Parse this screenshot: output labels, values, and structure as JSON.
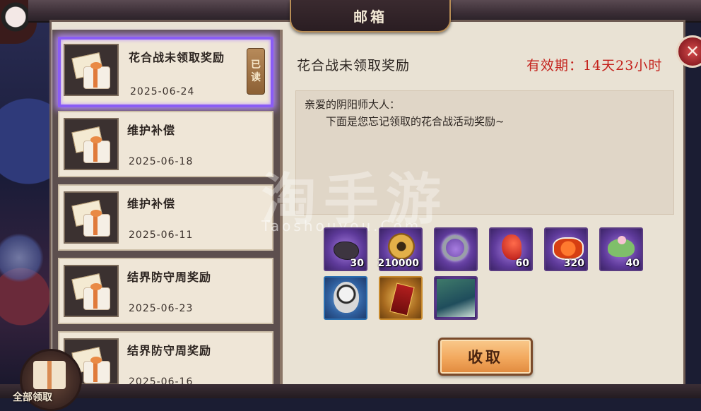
{
  "window": {
    "title": "邮箱",
    "close_icon": "✕"
  },
  "mail_list": [
    {
      "title": "花合战未领取奖励",
      "date": "2025-06-24",
      "selected": true,
      "read": true
    },
    {
      "title": "维护补偿",
      "date": "2025-06-18",
      "selected": false,
      "read": false
    },
    {
      "title": "维护补偿",
      "date": "2025-06-11",
      "selected": false,
      "read": false
    },
    {
      "title": "结界防守周奖励",
      "date": "2025-06-23",
      "selected": false,
      "read": false
    },
    {
      "title": "结界防守周奖励",
      "date": "2025-06-16",
      "selected": false,
      "read": false
    }
  ],
  "read_tag": {
    "char1": "已",
    "char2": "读"
  },
  "collect_all_label": "全部领取",
  "detail": {
    "title": "花合战未领取奖励",
    "validity": "有效期：14天23小时",
    "greeting": "亲爱的阴阳师大人：",
    "body": "下面是您忘记领取的花合战活动奖励~"
  },
  "rewards": [
    {
      "name": "black-stone-icon",
      "qty": "30",
      "rarity": "purple"
    },
    {
      "name": "gold-coin-icon",
      "qty": "210000",
      "rarity": "purple"
    },
    {
      "name": "jade-ring-icon",
      "qty": "",
      "rarity": "purple"
    },
    {
      "name": "red-magatama-icon",
      "qty": "60",
      "rarity": "purple"
    },
    {
      "name": "sushi-icon",
      "qty": "320",
      "rarity": "purple"
    },
    {
      "name": "sakura-mochi-icon",
      "qty": "40",
      "rarity": "purple"
    },
    {
      "name": "daruma-material-icon",
      "qty": "",
      "rarity": "blue"
    },
    {
      "name": "red-ticket-icon",
      "qty": "",
      "rarity": "gold"
    },
    {
      "name": "shikigami-portrait-icon",
      "qty": "",
      "rarity": "purple"
    }
  ],
  "collect_button": "收取",
  "watermark": {
    "main": "淘手游",
    "sub": "Taoshouyou.Com"
  },
  "colors": {
    "selected_border": "#8a5cf5",
    "validity_red": "#c4221c",
    "button_orange": "#f2a85d"
  }
}
